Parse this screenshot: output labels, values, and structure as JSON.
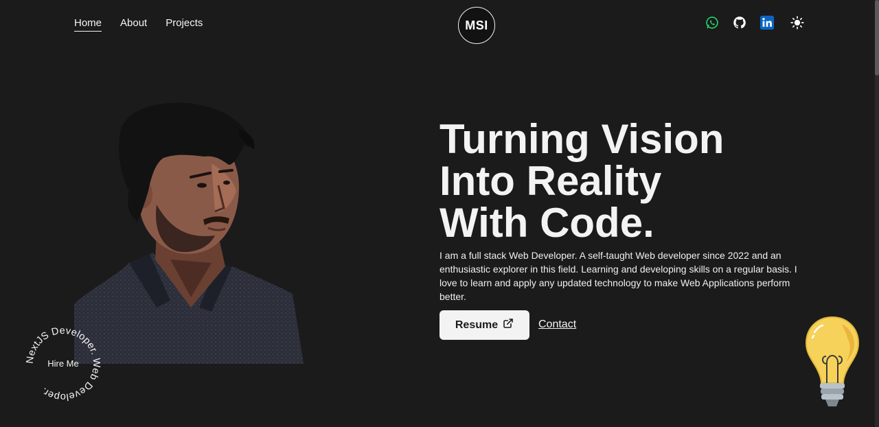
{
  "nav": {
    "links": [
      {
        "label": "Home",
        "active": true
      },
      {
        "label": "About",
        "active": false
      },
      {
        "label": "Projects",
        "active": false
      }
    ],
    "logo": "MSI",
    "socials": [
      "whatsapp-icon",
      "github-icon",
      "linkedin-icon",
      "sun-icon"
    ]
  },
  "hero": {
    "title_lines": [
      "Turning Vision",
      "Into Reality",
      "With Code."
    ],
    "description": "I am a full stack Web Developer. A self-taught Web developer since 2022 and an enthusiastic explorer in this field. Learning and developing skills on a regular basis. I love to learn and apply any updated technology to make Web Applications perform better.",
    "resume_label": "Resume",
    "contact_label": "Contact"
  },
  "badge": {
    "circle_text": "NextJS Developer. Web Developer. ",
    "center_label": "Hire Me"
  },
  "colors": {
    "background": "#1b1b1b",
    "text": "#f5f5f5",
    "whatsapp": "#25d366",
    "linkedin": "#0a66c2",
    "bulb": "#f7d25a"
  }
}
